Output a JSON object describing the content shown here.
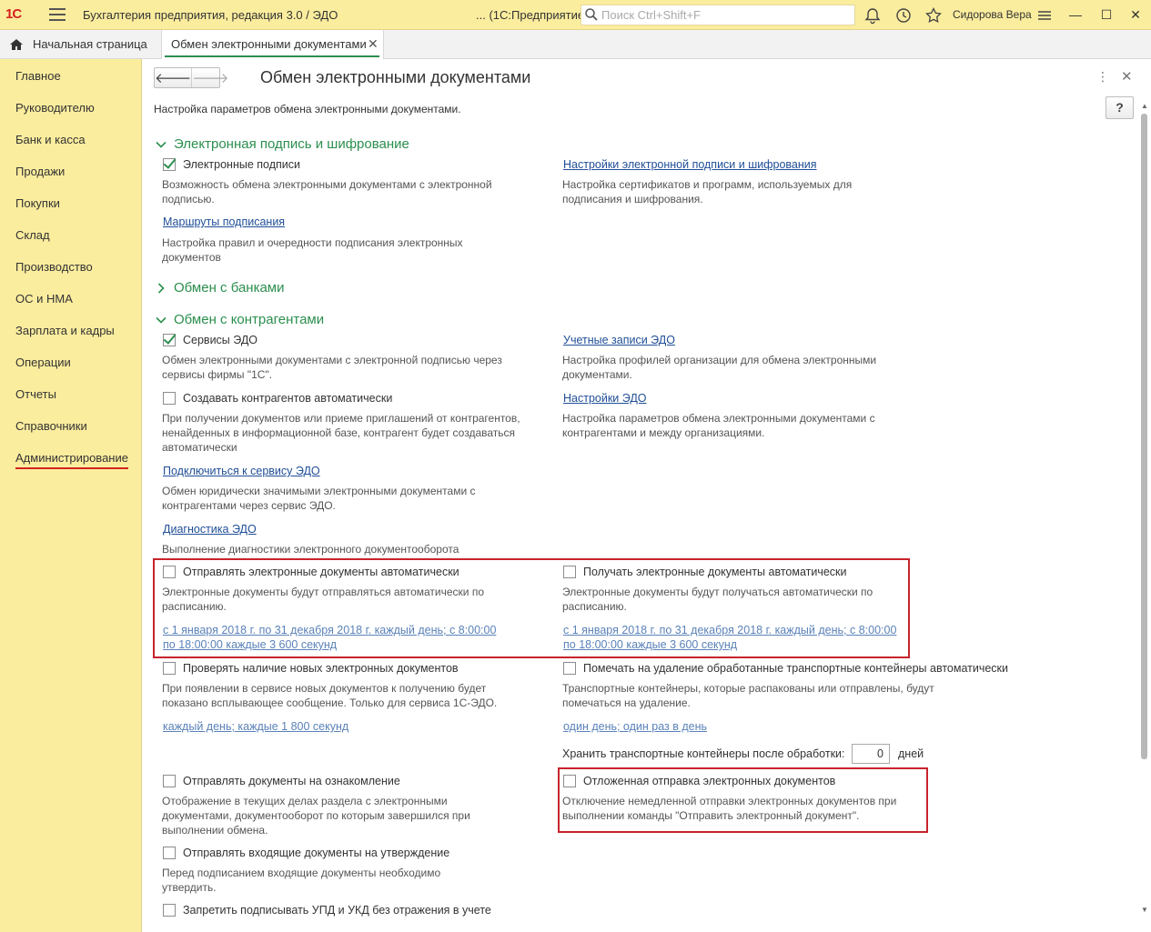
{
  "titlebar": {
    "logo": "1С",
    "app_title": "Бухгалтерия предприятия, редакция 3.0 / ЭДО",
    "app_mode": "...  (1С:Предприятие)",
    "search_placeholder": "Поиск Ctrl+Shift+F",
    "user": "Сидорова Вера"
  },
  "tabs": {
    "home_label": "Начальная страница",
    "active_label": "Обмен электронными документами"
  },
  "sidebar": {
    "items": [
      {
        "label": "Главное"
      },
      {
        "label": "Руководителю"
      },
      {
        "label": "Банк и касса"
      },
      {
        "label": "Продажи"
      },
      {
        "label": "Покупки"
      },
      {
        "label": "Склад"
      },
      {
        "label": "Производство"
      },
      {
        "label": "ОС и НМА"
      },
      {
        "label": "Зарплата и кадры"
      },
      {
        "label": "Операции"
      },
      {
        "label": "Отчеты"
      },
      {
        "label": "Справочники"
      },
      {
        "label": "Администрирование"
      }
    ],
    "active": "Администрирование"
  },
  "page": {
    "title": "Обмен электронными документами",
    "help": "?",
    "intro": "Настройка параметров обмена электронными документами."
  },
  "sections": {
    "signature": {
      "title": "Электронная подпись и шифрование",
      "expanded": true,
      "e_signatures": {
        "label": "Электронные подписи",
        "checked": true,
        "desc": "Возможность обмена электронными документами с электронной подписью."
      },
      "routes": {
        "label": "Маршруты подписания",
        "desc": "Настройка правил и очередности подписания электронных документов"
      },
      "settings": {
        "label": "Настройки электронной подписи и шифрования",
        "desc": "Настройка сертификатов и программ, используемых для подписания и шифрования."
      }
    },
    "banks": {
      "title": "Обмен с банками",
      "expanded": false
    },
    "counterparties": {
      "title": "Обмен с контрагентами",
      "expanded": true,
      "services": {
        "label": "Сервисы ЭДО",
        "checked": true,
        "desc": "Обмен электронными документами с электронной подписью через сервисы фирмы \"1С\"."
      },
      "accounts": {
        "label": "Учетные записи ЭДО",
        "desc": "Настройка профилей организации для обмена электронными документами."
      },
      "create_auto": {
        "label": "Создавать контрагентов автоматически",
        "checked": false,
        "desc": "При получении документов или приеме приглашений от контрагентов, ненайденных в информационной базе, контрагент будет создаваться автоматически"
      },
      "edo_settings": {
        "label": "Настройки ЭДО",
        "desc": "Настройка параметров обмена электронными документами с контрагентами и между организациями."
      },
      "connect": {
        "label": "Подключиться к сервису ЭДО",
        "desc": "Обмен юридически значимыми электронными документами с контрагентами через сервис ЭДО."
      },
      "diagnostics": {
        "label": "Диагностика ЭДО",
        "desc": "Выполнение диагностики электронного документооборота"
      },
      "send_auto": {
        "label": "Отправлять электронные документы автоматически",
        "checked": false,
        "desc": "Электронные документы будут отправляться автоматически по расписанию.",
        "schedule": "с 1 января 2018 г. по 31 декабря 2018 г. каждый день; с 8:00:00 по 18:00:00 каждые 3 600 секунд"
      },
      "receive_auto": {
        "label": "Получать электронные документы автоматически",
        "checked": false,
        "desc": "Электронные документы будут получаться автоматически по расписанию.",
        "schedule": "с 1 января 2018 г. по 31 декабря 2018 г. каждый день; с 8:00:00 по 18:00:00 каждые 3 600 секунд"
      },
      "check_new": {
        "label": "Проверять наличие новых электронных документов",
        "checked": false,
        "desc": "При появлении в сервисе новых документов к получению будет показано всплывающее сообщение. Только для сервиса 1С-ЭДО.",
        "schedule": "каждый день; каждые 1 800 секунд"
      },
      "mark_delete": {
        "label": "Помечать на удаление обработанные транспортные контейнеры автоматически",
        "checked": false,
        "desc": "Транспортные контейнеры, которые распакованы или отправлены, будут помечаться на удаление.",
        "schedule": "один день; один раз в день"
      },
      "keep_containers": {
        "label": "Хранить транспортные контейнеры после обработки:",
        "value": "0",
        "unit": "дней"
      },
      "send_review": {
        "label": "Отправлять документы на ознакомление",
        "checked": false,
        "desc": "Отображение в текущих делах  раздела с электронными документами, документооборот по которым завершился при выполнении обмена."
      },
      "deferred_send": {
        "label": "Отложенная отправка электронных документов",
        "checked": false,
        "desc": "Отключение немедленной отправки электронных документов при выполнении команды \"Отправить электронный документ\"."
      },
      "incoming_approval": {
        "label": "Отправлять входящие документы на утверждение",
        "checked": false,
        "desc": "Перед подписанием входящие документы необходимо утвердить."
      },
      "forbid_sign": {
        "label": "Запретить подписывать УПД и УКД без отражения в учете",
        "checked": false
      }
    }
  },
  "colors": {
    "accent_green": "#2b8f4e",
    "sidebar_yellow": "#fbed9e",
    "highlight_red": "#c8232b",
    "link_blue": "#1f4e97"
  }
}
